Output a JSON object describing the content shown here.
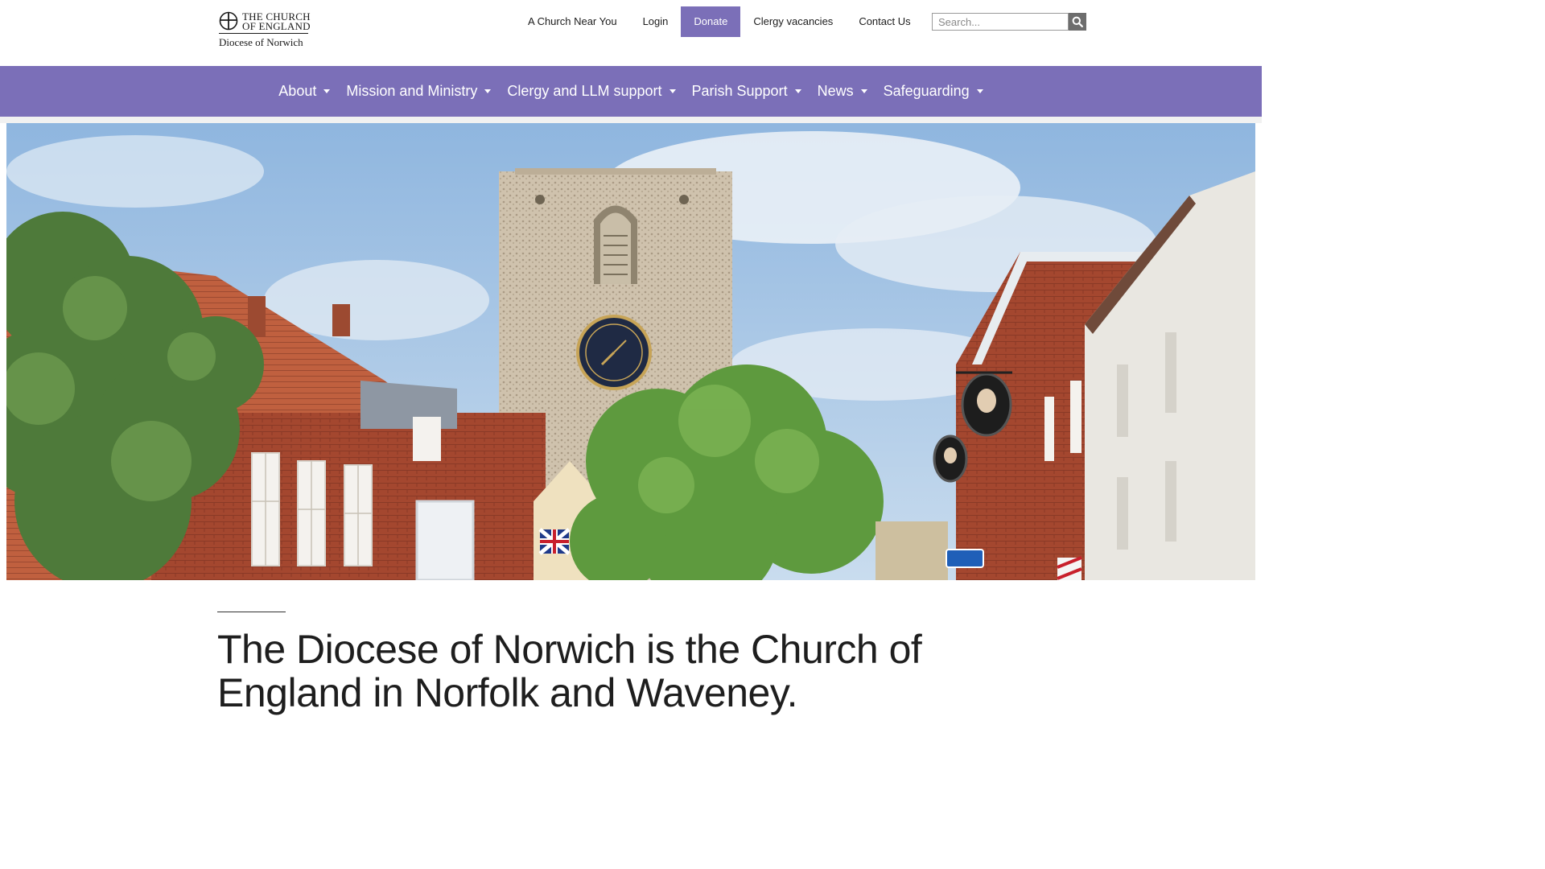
{
  "logo": {
    "line1": "THE CHURCH",
    "line2": "OF ENGLAND",
    "line3": "Diocese of Norwich",
    "icon": "church-of-england-cross-icon"
  },
  "utility_nav": [
    {
      "label": "A Church Near You"
    },
    {
      "label": "Login"
    },
    {
      "label": "Donate"
    },
    {
      "label": "Clergy vacancies"
    },
    {
      "label": "Contact Us"
    }
  ],
  "search": {
    "placeholder": "Search...",
    "value": "",
    "icon": "search-icon"
  },
  "main_nav": [
    {
      "label": "About"
    },
    {
      "label": "Mission and Ministry"
    },
    {
      "label": "Clergy and LLM support"
    },
    {
      "label": "Parish Support"
    },
    {
      "label": "News"
    },
    {
      "label": "Safeguarding"
    }
  ],
  "hero": {
    "alt": "Church tower with clock above a high street of red-brick houses and trees"
  },
  "content": {
    "headline": "The Diocese of Norwich is the Church of England in Norfolk and Waveney."
  },
  "colors": {
    "brand_purple": "#7b6fb8",
    "text_dark": "#1e1e1e",
    "search_button": "#6d6d6d"
  }
}
